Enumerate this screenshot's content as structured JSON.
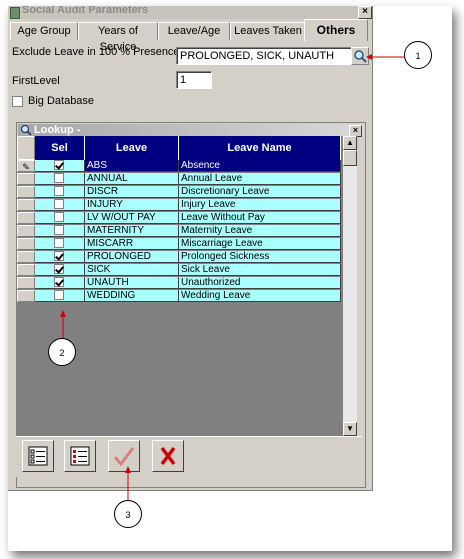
{
  "window": {
    "title": "Social Audit Parameters",
    "close": "×"
  },
  "tabs": [
    {
      "label": "Age Group"
    },
    {
      "label": "Years of Service"
    },
    {
      "label": "Leave/Age"
    },
    {
      "label": "Leaves Taken"
    },
    {
      "label": "Others"
    }
  ],
  "form": {
    "exclude_label": "Exclude Leave in 100 % Presence",
    "exclude_value": "PROLONGED, SICK, UNAUTH",
    "firstlevel_label": "FirstLevel",
    "firstlevel_value": "1",
    "bigdb_label": "Big Database",
    "bigdb_checked": false
  },
  "lookup": {
    "title": "Lookup -",
    "close": "×",
    "columns": [
      "Sel",
      "Leave",
      "Leave Name"
    ],
    "rows": [
      {
        "sel": true,
        "leave": "ABS",
        "name": "Absence",
        "current": true
      },
      {
        "sel": false,
        "leave": "ANNUAL",
        "name": "Annual Leave"
      },
      {
        "sel": false,
        "leave": "DISCR",
        "name": "Discretionary Leave"
      },
      {
        "sel": false,
        "leave": "INJURY",
        "name": "Injury Leave"
      },
      {
        "sel": false,
        "leave": "LV W/OUT PAY",
        "name": "Leave Without Pay"
      },
      {
        "sel": false,
        "leave": "MATERNITY",
        "name": "Maternity Leave"
      },
      {
        "sel": false,
        "leave": "MISCARR",
        "name": "Miscarriage Leave"
      },
      {
        "sel": true,
        "leave": "PROLONGED",
        "name": "Prolonged Sickness"
      },
      {
        "sel": true,
        "leave": "SICK",
        "name": "Sick Leave"
      },
      {
        "sel": true,
        "leave": "UNAUTH",
        "name": "Unauthorized"
      },
      {
        "sel": false,
        "leave": "WEDDING",
        "name": "Wedding Leave"
      }
    ]
  },
  "toolbar": {
    "buttons": [
      {
        "name": "select-all-button",
        "icon": "list-check-icon"
      },
      {
        "name": "deselect-all-button",
        "icon": "list-uncheck-icon"
      },
      {
        "name": "ok-button",
        "icon": "checkmark-icon"
      },
      {
        "name": "cancel-button",
        "icon": "x-icon"
      }
    ]
  },
  "callouts": [
    "1",
    "2",
    "3"
  ],
  "colors": {
    "header": "#000080",
    "row_bg": "#aaffff",
    "row_current": "#000080",
    "callout_line": "#cc0000"
  }
}
